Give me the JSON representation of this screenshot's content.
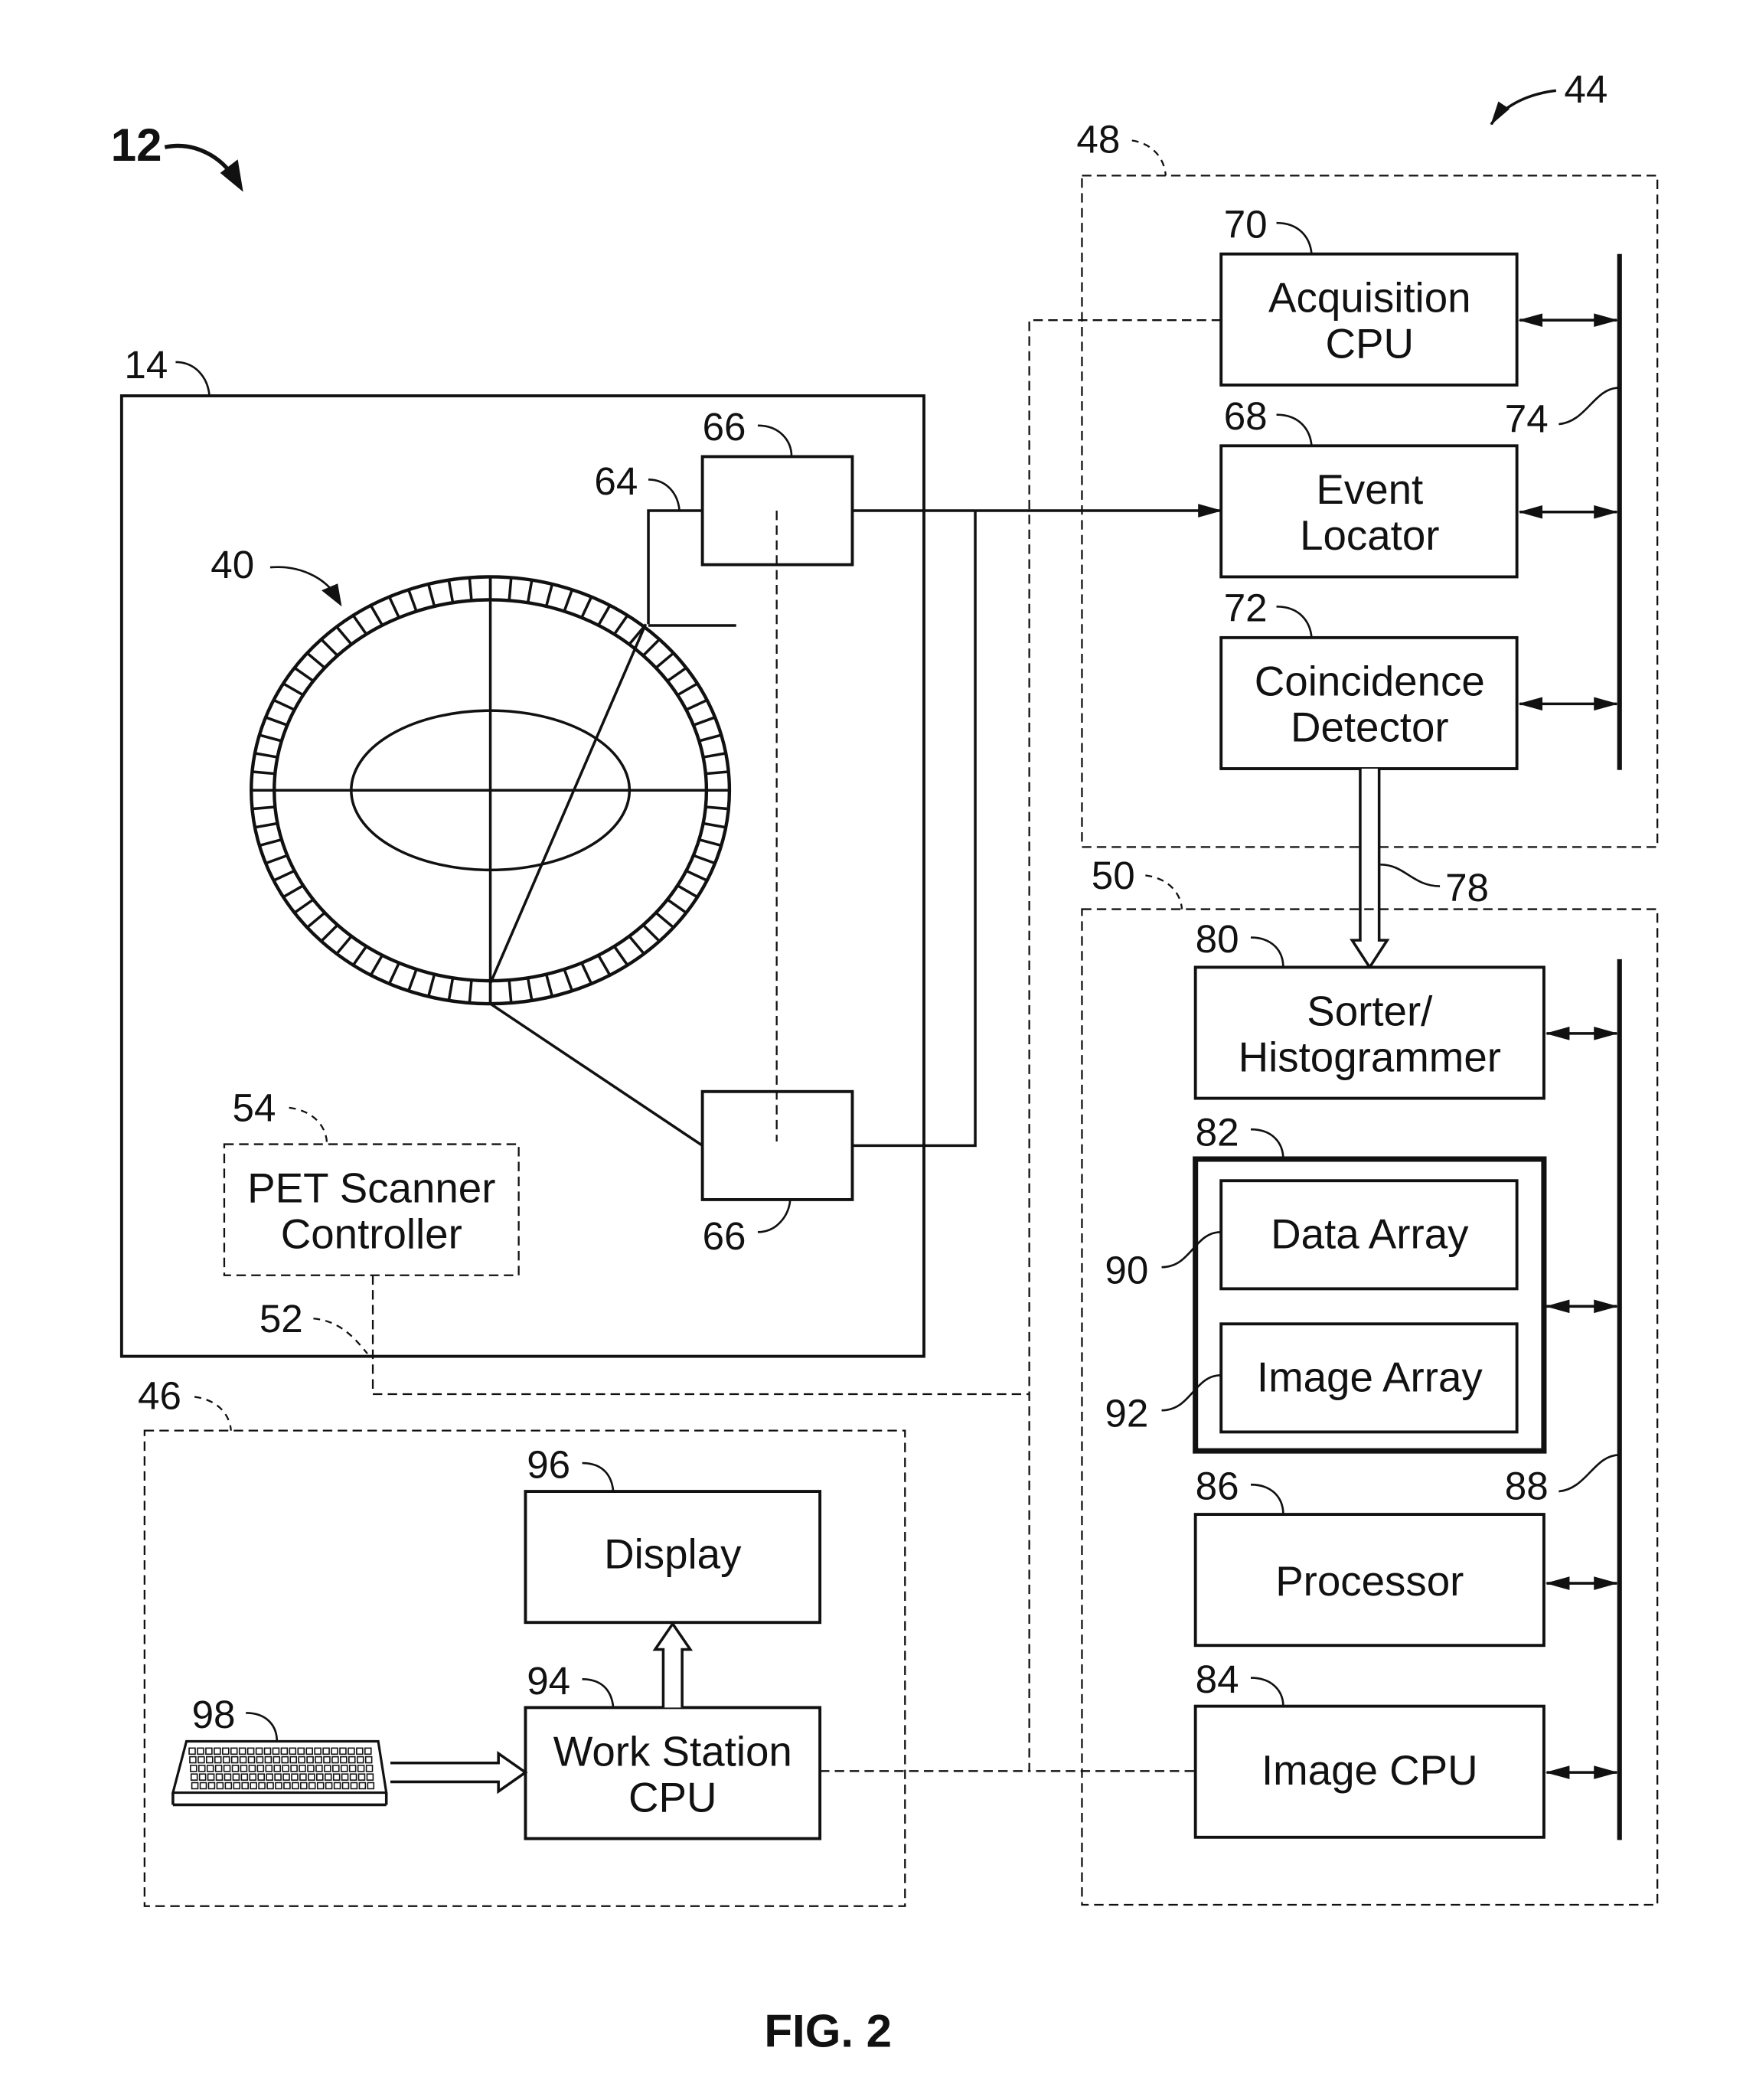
{
  "figure": {
    "caption": "FIG. 2",
    "system_ref": "12",
    "subsystem_ref": "44"
  },
  "scanner": {
    "ref": "14",
    "ring_ref": "40",
    "line_ref": "64",
    "detector_top_ref": "66",
    "detector_bottom_ref": "66",
    "controller": {
      "ref": "54",
      "line1": "PET Scanner",
      "line2": "Controller"
    },
    "link_ref": "52"
  },
  "acquisition_group": {
    "ref": "48",
    "bus_ref": "74",
    "blocks": [
      {
        "ref": "70",
        "line1": "Acquisition",
        "line2": "CPU"
      },
      {
        "ref": "68",
        "line1": "Event",
        "line2": "Locator"
      },
      {
        "ref": "72",
        "line1": "Coincidence",
        "line2": "Detector"
      }
    ],
    "link_ref": "78"
  },
  "reconstruction_group": {
    "ref": "50",
    "bus_ref": "88",
    "sorter": {
      "ref": "80",
      "line1": "Sorter/",
      "line2": "Histogrammer"
    },
    "memory": {
      "ref": "82",
      "data_array": {
        "ref": "90",
        "label": "Data Array"
      },
      "image_array": {
        "ref": "92",
        "label": "Image Array"
      }
    },
    "processor": {
      "ref": "86",
      "label": "Processor"
    },
    "image_cpu": {
      "ref": "84",
      "label": "Image CPU"
    }
  },
  "workstation_group": {
    "ref": "46",
    "display": {
      "ref": "96",
      "label": "Display"
    },
    "cpu": {
      "ref": "94",
      "line1": "Work Station",
      "line2": "CPU"
    },
    "keyboard": {
      "ref": "98"
    }
  }
}
